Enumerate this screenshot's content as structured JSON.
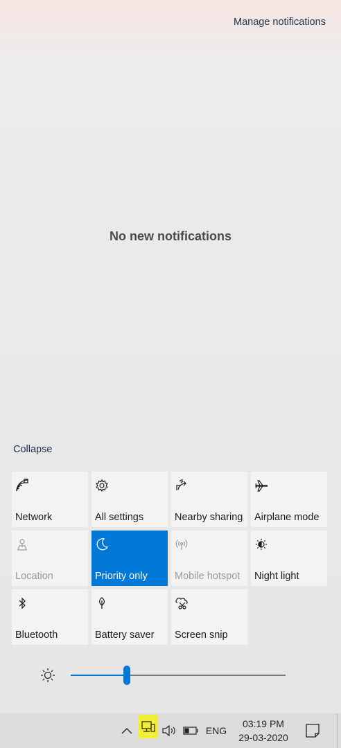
{
  "header": {
    "manage_label": "Manage notifications"
  },
  "notifications": {
    "empty_text": "No new notifications"
  },
  "quick_actions": {
    "collapse_label": "Collapse",
    "tiles": [
      {
        "label": "Network",
        "icon": "network-icon",
        "state": "normal"
      },
      {
        "label": "All settings",
        "icon": "gear-icon",
        "state": "normal"
      },
      {
        "label": "Nearby sharing",
        "icon": "share-icon",
        "state": "normal"
      },
      {
        "label": "Airplane mode",
        "icon": "airplane-icon",
        "state": "normal"
      },
      {
        "label": "Location",
        "icon": "location-icon",
        "state": "disabled"
      },
      {
        "label": "Priority only",
        "icon": "moon-icon",
        "state": "active"
      },
      {
        "label": "Mobile hotspot",
        "icon": "hotspot-icon",
        "state": "disabled"
      },
      {
        "label": "Night light",
        "icon": "night-light-icon",
        "state": "normal"
      },
      {
        "label": "Bluetooth",
        "icon": "bluetooth-icon",
        "state": "normal"
      },
      {
        "label": "Battery saver",
        "icon": "battery-saver-icon",
        "state": "normal"
      },
      {
        "label": "Screen snip",
        "icon": "screen-snip-icon",
        "state": "normal"
      }
    ]
  },
  "brightness": {
    "value_fraction": 0.26,
    "icon": "sun-icon"
  },
  "taskbar": {
    "language": "ENG",
    "time": "03:19 PM",
    "date": "29-03-2020",
    "network_highlight_color": "#f0ef33"
  },
  "colors": {
    "accent": "#0078d7",
    "tile_bg": "#f3f3f3",
    "link": "#1f2d4a"
  }
}
